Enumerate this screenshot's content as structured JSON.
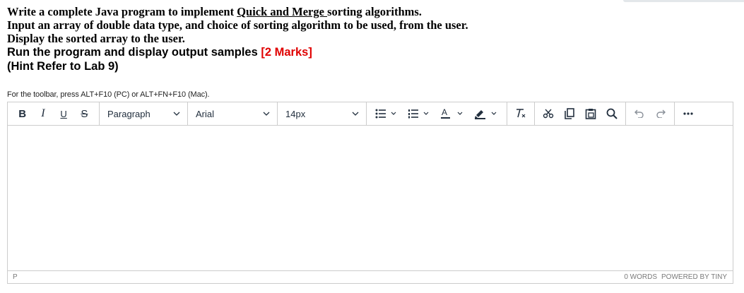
{
  "question": {
    "line1_before": "Write a complete Java program to implement ",
    "line1_link": "Quick and Merge ",
    "line1_after": "sorting algorithms.",
    "line2": "Input an array of double data type, and choice of sorting algorithm to be used, from the user.",
    "line3": "Display the sorted array to the user.",
    "line4": "Run the program and display output samples ",
    "line4_marks": "[2 Marks]",
    "line5": "(Hint Refer to Lab 9)"
  },
  "editor": {
    "a11y_hint": "For the toolbar, press ALT+F10 (PC) or ALT+FN+F10 (Mac).",
    "toolbar": {
      "bold": "B",
      "italic": "I",
      "underline": "U",
      "strikethrough": "S",
      "block_format": "Paragraph",
      "font_family": "Arial",
      "font_size": "14px"
    },
    "status": {
      "path": "P",
      "word_count": "0 WORDS",
      "powered_by": "POWERED BY TINY"
    }
  },
  "colors": {
    "marks_red": "#e00000",
    "border": "#cccccc",
    "icon": "#222f3e"
  }
}
